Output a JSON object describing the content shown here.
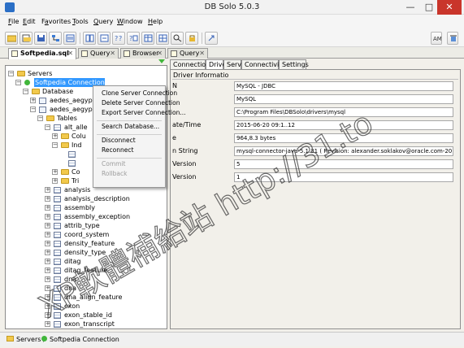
{
  "window": {
    "title": "DB Solo  5.0.3",
    "controls": [
      "—",
      "□",
      "✕"
    ]
  },
  "menu": [
    {
      "label": "File",
      "u": "F"
    },
    {
      "label": "Edit",
      "u": "E"
    },
    {
      "label": "Favorites",
      "u": "a"
    },
    {
      "label": "Tools",
      "u": "T"
    },
    {
      "label": "Query",
      "u": "Q"
    },
    {
      "label": "Window",
      "u": "W"
    },
    {
      "label": "Help",
      "u": "H"
    }
  ],
  "toolbar": {
    "icons": [
      "open-folder-icon",
      "open-file-icon",
      "save-icon",
      "schema-icon",
      "db-icon",
      "compare-icon",
      "refresh-icon",
      "query-icon",
      "help-query-icon",
      "search-icon",
      "lock-icon",
      "export-icon"
    ],
    "right_label": "AMX",
    "trash_icon": "trash-icon"
  },
  "doc_tabs": [
    {
      "label": "Softpedia.sql",
      "active": true
    },
    {
      "label": "Query",
      "active": false
    },
    {
      "label": "Browser",
      "active": false
    },
    {
      "label": "Query",
      "active": false
    }
  ],
  "tree": {
    "root": "Servers",
    "connection": "Softpedia Connection",
    "rows": [
      {
        "label": "Servers",
        "indent": 0,
        "kind": "folder",
        "exp": "−"
      },
      {
        "label": "Softpedia Connection",
        "indent": 1,
        "kind": "conn",
        "exp": "−",
        "selected": true
      },
      {
        "label": "Database",
        "indent": 2,
        "kind": "folder",
        "exp": "−"
      },
      {
        "label": "aedes_aegypti",
        "indent": 3,
        "kind": "db",
        "exp": "+"
      },
      {
        "label": "aedes_aegypti",
        "indent": 3,
        "kind": "db",
        "exp": "−"
      },
      {
        "label": "Tables",
        "indent": 4,
        "kind": "folder",
        "exp": "−"
      },
      {
        "label": "alt_alle",
        "indent": 5,
        "kind": "table",
        "exp": "−"
      },
      {
        "label": "Colu",
        "indent": 6,
        "kind": "folder",
        "exp": "+"
      },
      {
        "label": "Ind",
        "indent": 6,
        "kind": "folder",
        "exp": "−"
      },
      {
        "label": "",
        "indent": 7,
        "kind": "table",
        "exp": ""
      },
      {
        "label": "",
        "indent": 7,
        "kind": "table",
        "exp": ""
      },
      {
        "label": "Co",
        "indent": 6,
        "kind": "folder",
        "exp": "+"
      },
      {
        "label": "Tri",
        "indent": 6,
        "kind": "folder",
        "exp": "+"
      },
      {
        "label": "analysis",
        "indent": 5,
        "kind": "table",
        "exp": "+"
      },
      {
        "label": "analysis_description",
        "indent": 5,
        "kind": "table",
        "exp": "+"
      },
      {
        "label": "assembly",
        "indent": 5,
        "kind": "table",
        "exp": "+"
      },
      {
        "label": "assembly_exception",
        "indent": 5,
        "kind": "table",
        "exp": "+"
      },
      {
        "label": "attrib_type",
        "indent": 5,
        "kind": "table",
        "exp": "+"
      },
      {
        "label": "coord_system",
        "indent": 5,
        "kind": "table",
        "exp": "+"
      },
      {
        "label": "density_feature",
        "indent": 5,
        "kind": "table",
        "exp": "+"
      },
      {
        "label": "density_type",
        "indent": 5,
        "kind": "table",
        "exp": "+"
      },
      {
        "label": "ditag",
        "indent": 5,
        "kind": "table",
        "exp": "+"
      },
      {
        "label": "ditag_feature",
        "indent": 5,
        "kind": "table",
        "exp": "+"
      },
      {
        "label": "dna",
        "indent": 5,
        "kind": "table",
        "exp": "+"
      },
      {
        "label": "dna",
        "indent": 5,
        "kind": "table",
        "exp": "+"
      },
      {
        "label": "dna_align_feature",
        "indent": 5,
        "kind": "table",
        "exp": "+"
      },
      {
        "label": "exon",
        "indent": 5,
        "kind": "table",
        "exp": "+"
      },
      {
        "label": "exon_stable_id",
        "indent": 5,
        "kind": "table",
        "exp": "+"
      },
      {
        "label": "exon_transcript",
        "indent": 5,
        "kind": "table",
        "exp": "+"
      }
    ]
  },
  "right_tabs": [
    {
      "label": "Connection",
      "active": false
    },
    {
      "label": "Drive",
      "active": true
    },
    {
      "label": "Serve",
      "active": false
    },
    {
      "label": "Connectivity",
      "active": false
    },
    {
      "label": "Settings",
      "active": false
    }
  ],
  "driver_info": {
    "section_title": "Driver Informatio",
    "rows": [
      {
        "label": "N",
        "value": "MySQL - JDBC"
      },
      {
        "label": "",
        "value": "MySQL"
      },
      {
        "label": "",
        "value": "C:\\Program Files\\DBSolo\\drivers\\mysql"
      },
      {
        "label": "ate/Time",
        "value": "2015-06-20 09:1..12"
      },
      {
        "label": "e",
        "value": "964,8.3 bytes"
      },
      {
        "label": "n String",
        "value": "mysql-connector-java-5.1.31 ( Revision: alexander.soklakov@oracle.com-20140520065950-groqzzbvxprqdmnz )"
      },
      {
        "label": "Version",
        "value": "5"
      },
      {
        "label": "Version",
        "value": "1"
      }
    ]
  },
  "context_menu": {
    "items": [
      {
        "label": "Clone Server Connection",
        "disabled": false
      },
      {
        "label": "Delete Server Connection",
        "disabled": false
      },
      {
        "label": "Export Server Connection...",
        "disabled": false
      },
      {
        "sep": true
      },
      {
        "label": "Search Database...",
        "disabled": false
      },
      {
        "sep": true
      },
      {
        "label": "Disconnect",
        "disabled": false
      },
      {
        "label": "Reconnect",
        "disabled": false
      },
      {
        "sep": true
      },
      {
        "label": "Commit",
        "disabled": true
      },
      {
        "label": "Rollback",
        "disabled": true
      }
    ]
  },
  "status": {
    "servers": "Servers /",
    "connection": "Softpedia Connection"
  },
  "watermark": "XP軟體補給站 http://31.to",
  "colors": {
    "selection": "#3399ff",
    "folder": "#f2c94c",
    "connection_ok": "#41b63b",
    "close_button": "#c9352b"
  }
}
